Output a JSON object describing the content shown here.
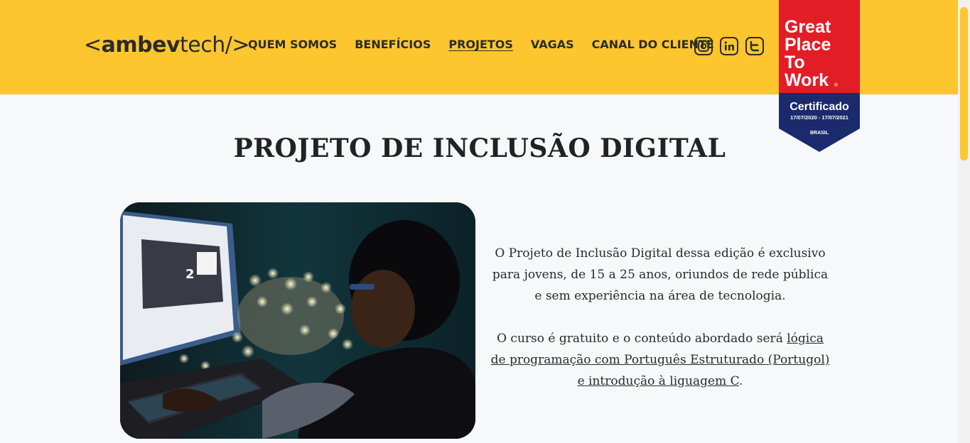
{
  "header": {
    "logo": {
      "open": "<",
      "bold": "ambev",
      "regular": "tech",
      "close": "/>"
    },
    "nav": [
      {
        "label": "QUEM SOMOS",
        "active": false
      },
      {
        "label": "BENEFÍCIOS",
        "active": false
      },
      {
        "label": "PROJETOS",
        "active": true
      },
      {
        "label": "VAGAS",
        "active": false
      },
      {
        "label": "CANAL DO CLIENTE",
        "active": false
      }
    ],
    "social_icons": [
      "instagram-icon",
      "linkedin-icon",
      "twitter-icon"
    ],
    "bg_color": "#fec62e"
  },
  "badge": {
    "line1": "Great",
    "line2": "Place",
    "line3": "To",
    "line4": "Work",
    "reg": "®",
    "certified": "Certificado",
    "dates": "17/07/2020 - 17/07/2021",
    "country": "BRASIL",
    "colors": {
      "red": "#e31d25",
      "navy": "#1a2a6c"
    }
  },
  "main": {
    "title": "PROJETO DE INCLUSÃO DIGITAL",
    "paragraph1": "O Projeto de Inclusão Digital dessa edição é exclusivo para jovens, de 15 a 25 anos, oriundos de rede pública e sem experiência na área de tecnologia.",
    "paragraph2_prefix": "O curso é gratuito e o conteúdo abordado será ",
    "paragraph2_link": "lógica de programação com Português Estruturado (Portugol) e introdução à liguagem C",
    "paragraph2_suffix": "."
  }
}
